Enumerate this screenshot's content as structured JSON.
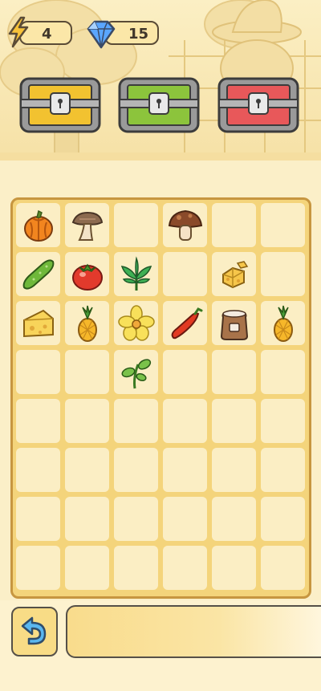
{
  "resources": {
    "energy": {
      "icon": "lightning-icon",
      "value": "4"
    },
    "gems": {
      "icon": "blue-gem-icon",
      "value": "15"
    }
  },
  "chests": [
    {
      "name": "yellow-chest",
      "color": "#f2c230"
    },
    {
      "name": "green-chest",
      "color": "#8cc43c"
    },
    {
      "name": "red-chest",
      "color": "#e8585a"
    }
  ],
  "board": {
    "columns": 6,
    "rows": 8,
    "items": [
      {
        "row": 0,
        "col": 0,
        "item": "pumpkin-icon"
      },
      {
        "row": 0,
        "col": 1,
        "item": "oyster-mushroom-icon"
      },
      {
        "row": 0,
        "col": 3,
        "item": "brown-mushroom-icon"
      },
      {
        "row": 1,
        "col": 0,
        "item": "cucumber-icon"
      },
      {
        "row": 1,
        "col": 1,
        "item": "tomato-icon"
      },
      {
        "row": 1,
        "col": 2,
        "item": "green-sprout-icon"
      },
      {
        "row": 1,
        "col": 4,
        "item": "cheese-chunks-icon"
      },
      {
        "row": 2,
        "col": 0,
        "item": "cheese-wedge-icon"
      },
      {
        "row": 2,
        "col": 1,
        "item": "pineapple-icon"
      },
      {
        "row": 2,
        "col": 2,
        "item": "yellow-flower-icon"
      },
      {
        "row": 2,
        "col": 3,
        "item": "red-chili-icon"
      },
      {
        "row": 2,
        "col": 4,
        "item": "flour-sack-icon"
      },
      {
        "row": 2,
        "col": 5,
        "item": "pineapple-icon"
      },
      {
        "row": 3,
        "col": 2,
        "item": "seedling-icon"
      }
    ]
  },
  "bottom_bar": {
    "undo_icon": "undo-arrow-icon",
    "info_text": ""
  }
}
